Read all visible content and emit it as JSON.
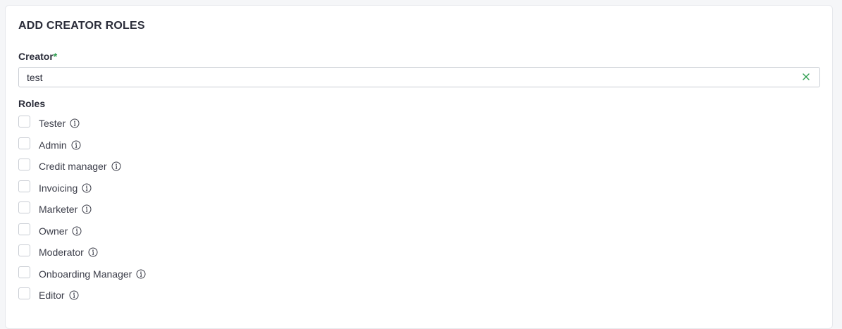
{
  "form": {
    "title": "ADD CREATOR ROLES",
    "creator_label": "Creator",
    "required_mark": "*",
    "creator_value": "test",
    "roles_label": "Roles"
  },
  "roles": [
    {
      "label": "Tester",
      "checked": false
    },
    {
      "label": "Admin",
      "checked": false
    },
    {
      "label": "Credit manager",
      "checked": false
    },
    {
      "label": "Invoicing",
      "checked": false
    },
    {
      "label": "Marketer",
      "checked": false
    },
    {
      "label": "Owner",
      "checked": false
    },
    {
      "label": "Moderator",
      "checked": false
    },
    {
      "label": "Onboarding Manager",
      "checked": false
    },
    {
      "label": "Editor",
      "checked": false
    }
  ],
  "colors": {
    "accent": "#2e9e4f",
    "border": "#c9cdd4",
    "text": "#2b2d3a"
  },
  "icons": {
    "clear": "close-icon",
    "info": "info-icon"
  }
}
